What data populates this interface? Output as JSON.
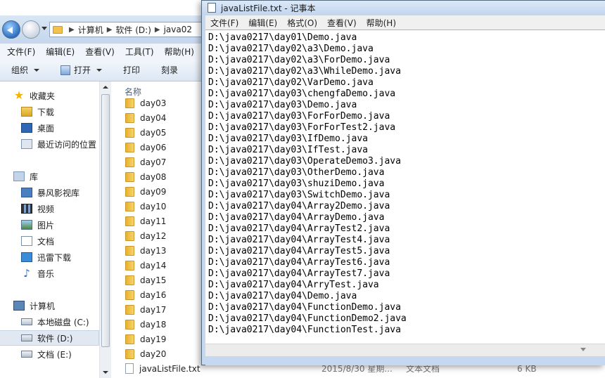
{
  "explorer": {
    "breadcrumb": [
      "计算机",
      "软件 (D:)",
      "java02"
    ],
    "menu": [
      "文件(F)",
      "编辑(E)",
      "查看(V)",
      "工具(T)",
      "帮助(H)"
    ],
    "toolbar": {
      "organize": "组织",
      "open": "打开",
      "print": "打印",
      "burn": "刻录"
    },
    "nav": {
      "favorites": "收藏夹",
      "downloads": "下载",
      "desktop": "桌面",
      "recent": "最近访问的位置",
      "libraries": "库",
      "baofeng": "暴风影视库",
      "videos": "视频",
      "pictures": "图片",
      "documents": "文档",
      "xunlei": "迅雷下载",
      "music": "音乐",
      "computer": "计算机",
      "drive_c": "本地磁盘 (C:)",
      "drive_d": "软件 (D:)",
      "drive_e": "文档 (E:)"
    },
    "column_name": "名称",
    "folders": [
      "day03",
      "day04",
      "day05",
      "day06",
      "day07",
      "day08",
      "day09",
      "day10",
      "day11",
      "day12",
      "day13",
      "day14",
      "day15",
      "day16",
      "day17",
      "day18",
      "day19",
      "day20"
    ],
    "txt_file": {
      "name": "javaListFile.txt",
      "date": "2015/8/30 星期...",
      "type": "文本文档",
      "size": "6 KB"
    }
  },
  "notepad": {
    "title": "javaListFile.txt - 记事本",
    "menu": [
      "文件(F)",
      "编辑(E)",
      "格式(O)",
      "查看(V)",
      "帮助(H)"
    ],
    "lines": [
      "D:\\java0217\\day01\\Demo.java",
      "D:\\java0217\\day02\\a3\\Demo.java",
      "D:\\java0217\\day02\\a3\\ForDemo.java",
      "D:\\java0217\\day02\\a3\\WhileDemo.java",
      "D:\\java0217\\day02\\VarDemo.java",
      "D:\\java0217\\day03\\chengfaDemo.java",
      "D:\\java0217\\day03\\Demo.java",
      "D:\\java0217\\day03\\ForForDemo.java",
      "D:\\java0217\\day03\\ForForTest2.java",
      "D:\\java0217\\day03\\IfDemo.java",
      "D:\\java0217\\day03\\IfTest.java",
      "D:\\java0217\\day03\\OperateDemo3.java",
      "D:\\java0217\\day03\\OtherDemo.java",
      "D:\\java0217\\day03\\shuziDemo.java",
      "D:\\java0217\\day03\\SwitchDemo.java",
      "D:\\java0217\\day04\\Array2Demo.java",
      "D:\\java0217\\day04\\ArrayDemo.java",
      "D:\\java0217\\day04\\ArrayTest2.java",
      "D:\\java0217\\day04\\ArrayTest4.java",
      "D:\\java0217\\day04\\ArrayTest5.java",
      "D:\\java0217\\day04\\ArrayTest6.java",
      "D:\\java0217\\day04\\ArrayTest7.java",
      "D:\\java0217\\day04\\ArryTest.java",
      "D:\\java0217\\day04\\Demo.java",
      "D:\\java0217\\day04\\FunctionDemo.java",
      "D:\\java0217\\day04\\FunctionDemo2.java",
      "D:\\java0217\\day04\\FunctionTest.java"
    ]
  }
}
